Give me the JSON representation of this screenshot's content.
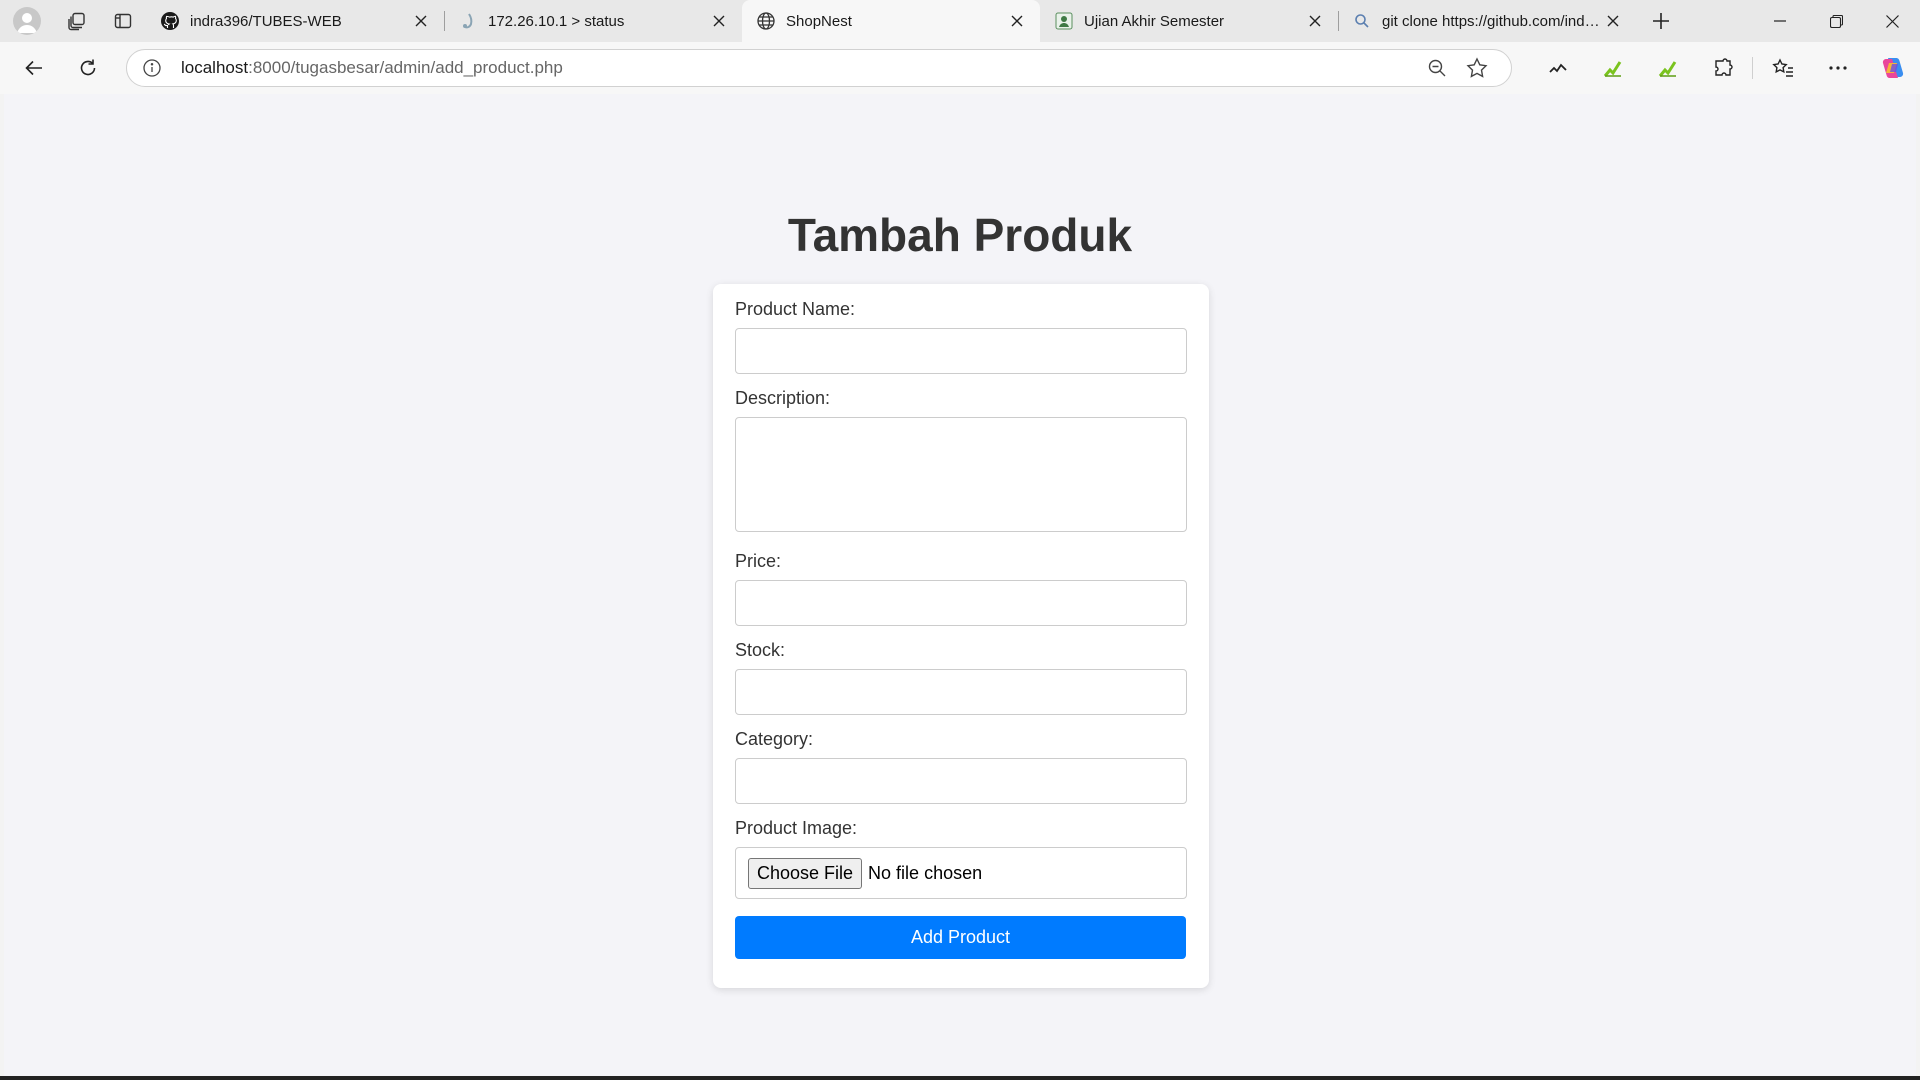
{
  "browser": {
    "tabs": [
      {
        "title": "indra396/TUBES-WEB",
        "icon": "github-icon",
        "active": false
      },
      {
        "title": "172.26.10.1 > status",
        "icon": "status-icon",
        "active": false
      },
      {
        "title": "ShopNest",
        "icon": "globe-icon",
        "active": true
      },
      {
        "title": "Ujian Akhir Semester",
        "icon": "school-icon",
        "active": false
      },
      {
        "title": "git clone https://github.com/indra396",
        "icon": "search-icon",
        "active": false
      }
    ],
    "address": {
      "host": "localhost",
      "path": ":8000/tugasbesar/admin/add_product.php"
    },
    "accent_color": "#7ac31e"
  },
  "page": {
    "title": "Tambah Produk",
    "form": {
      "product_name": {
        "label": "Product Name:",
        "value": ""
      },
      "description": {
        "label": "Description:",
        "value": ""
      },
      "price": {
        "label": "Price:",
        "value": ""
      },
      "stock": {
        "label": "Stock:",
        "value": ""
      },
      "category": {
        "label": "Category:",
        "value": ""
      },
      "image": {
        "label": "Product Image:",
        "button": "Choose File",
        "status": "No file chosen"
      },
      "submit_label": "Add Product"
    },
    "button_color": "#007bff"
  }
}
